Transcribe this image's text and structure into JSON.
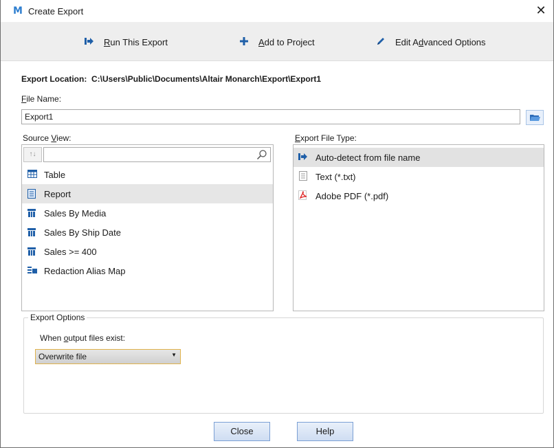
{
  "window": {
    "logo": "M",
    "title": "Create Export",
    "close": "✕"
  },
  "toolbar": {
    "run": {
      "label": "Run This Export",
      "icon": "run-arrow-icon"
    },
    "add": {
      "label": "Add to Project",
      "icon": "plus-icon"
    },
    "edit": {
      "label": "Edit Advanced Options",
      "icon": "pencil-icon"
    }
  },
  "export_location": {
    "label": "Export Location:",
    "value": "C:\\Users\\Public\\Documents\\Altair Monarch\\Export\\Export1"
  },
  "file_name": {
    "label": "File Name:",
    "value": "Export1"
  },
  "source_view": {
    "label": "Source View:",
    "search_value": "",
    "items": [
      {
        "label": "Table",
        "icon": "table-icon",
        "selected": false
      },
      {
        "label": "Report",
        "icon": "report-icon",
        "selected": true
      },
      {
        "label": "Sales By Media",
        "icon": "summary-icon",
        "selected": false
      },
      {
        "label": "Sales By Ship Date",
        "icon": "summary-icon",
        "selected": false
      },
      {
        "label": "Sales >= 400",
        "icon": "summary-icon",
        "selected": false
      },
      {
        "label": "Redaction Alias Map",
        "icon": "alias-map-icon",
        "selected": false
      }
    ]
  },
  "export_file_type": {
    "label": "Export File Type:",
    "items": [
      {
        "label": "Auto-detect from file name",
        "icon": "auto-detect-icon",
        "selected": true
      },
      {
        "label": "Text (*.txt)",
        "icon": "text-file-icon",
        "selected": false
      },
      {
        "label": "Adobe PDF (*.pdf)",
        "icon": "pdf-icon",
        "selected": false
      }
    ]
  },
  "export_options": {
    "legend": "Export Options",
    "when_exists_label": "When output files exist:",
    "when_exists_value": "Overwrite file"
  },
  "buttons": {
    "close": "Close",
    "help": "Help"
  },
  "colors": {
    "accent": "#1f5fa8",
    "selection": "#e6e6e6",
    "combo_border": "#e0b24a",
    "button_border": "#7a9fd4"
  }
}
